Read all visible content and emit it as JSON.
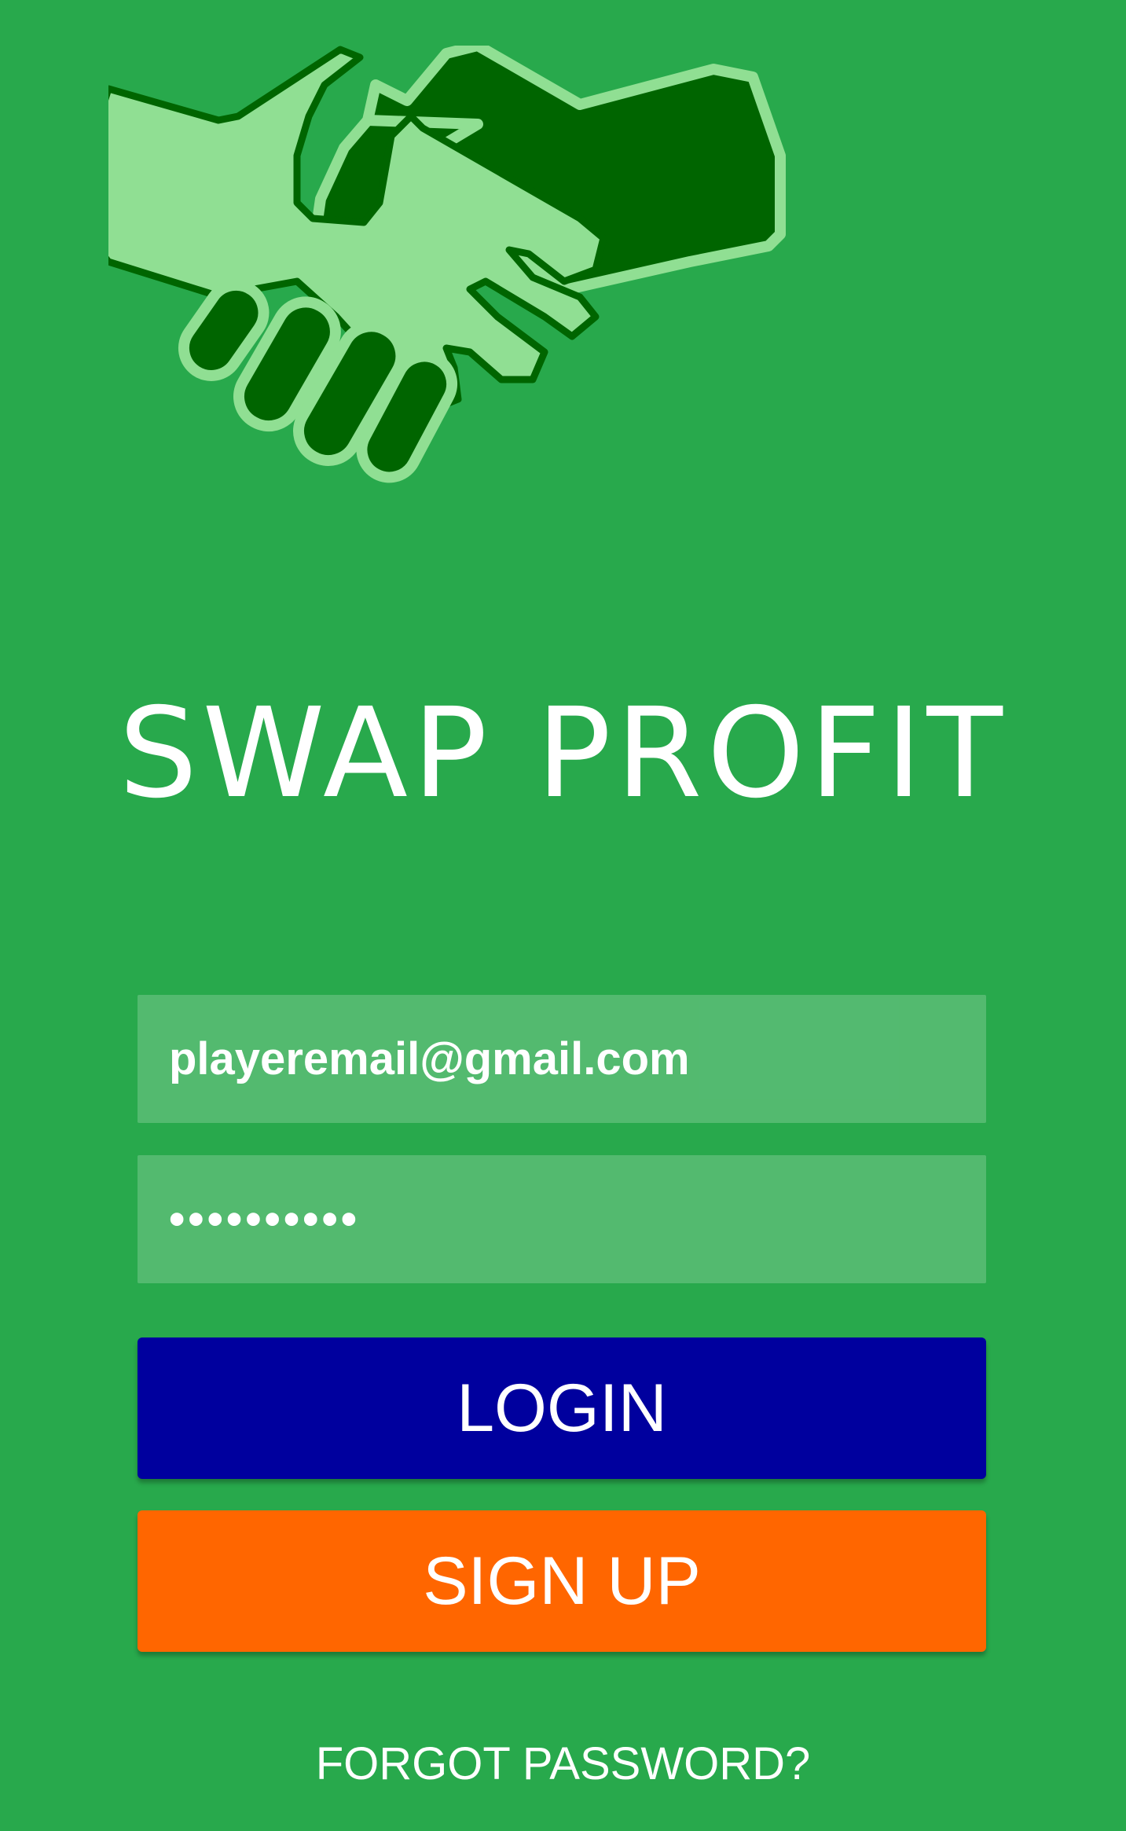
{
  "logo": {
    "icon": "handshake-icon"
  },
  "app": {
    "title": "SWAP PROFIT"
  },
  "login_form": {
    "email_value": "playeremail@gmail.com",
    "password_value": "••••••••••",
    "login_label": "LOGIN",
    "signup_label": "SIGN UP",
    "forgot_label": "FORGOT PASSWORD?"
  },
  "colors": {
    "background": "#28a94c",
    "hand_light": "#90df93",
    "hand_dark": "#006500",
    "login_button": "#00009e",
    "signup_button": "#ff6600"
  }
}
